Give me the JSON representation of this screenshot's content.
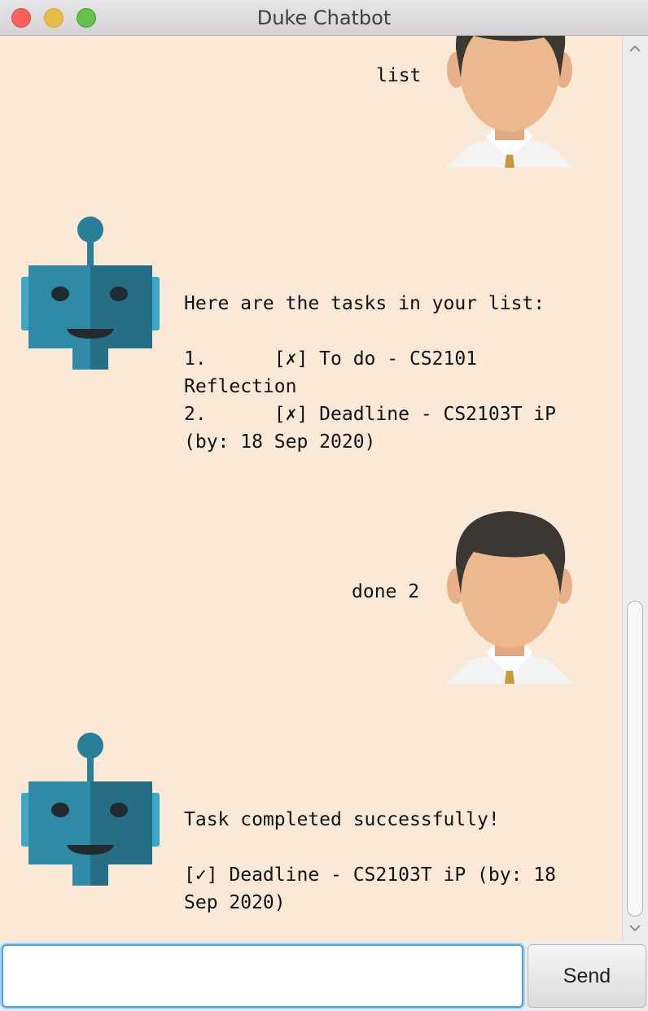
{
  "window": {
    "title": "Duke Chatbot"
  },
  "messages": [
    {
      "from": "user",
      "text": "list"
    },
    {
      "from": "bot",
      "text": "Here are the tasks in your list:\n\n1.      [✗] To do - CS2101\nReflection\n2.      [✗] Deadline - CS2103T iP\n(by: 18 Sep 2020)"
    },
    {
      "from": "user",
      "text": "done 2"
    },
    {
      "from": "bot",
      "text": "Task completed successfully!\n\n[✓] Deadline - CS2103T iP (by: 18\nSep 2020)"
    }
  ],
  "icons": {
    "user_avatar": "user-avatar-icon",
    "bot_avatar": "robot-avatar-icon",
    "scroll_up": "chevron-up-icon",
    "scroll_down": "chevron-down-icon"
  },
  "input": {
    "value": "",
    "placeholder": ""
  },
  "send_button": {
    "label": "Send"
  },
  "colors": {
    "chat_background": "#fae9d6",
    "robot_primary": "#2f8aa6",
    "robot_dark": "#246e86",
    "input_focus": "#4da3da"
  }
}
